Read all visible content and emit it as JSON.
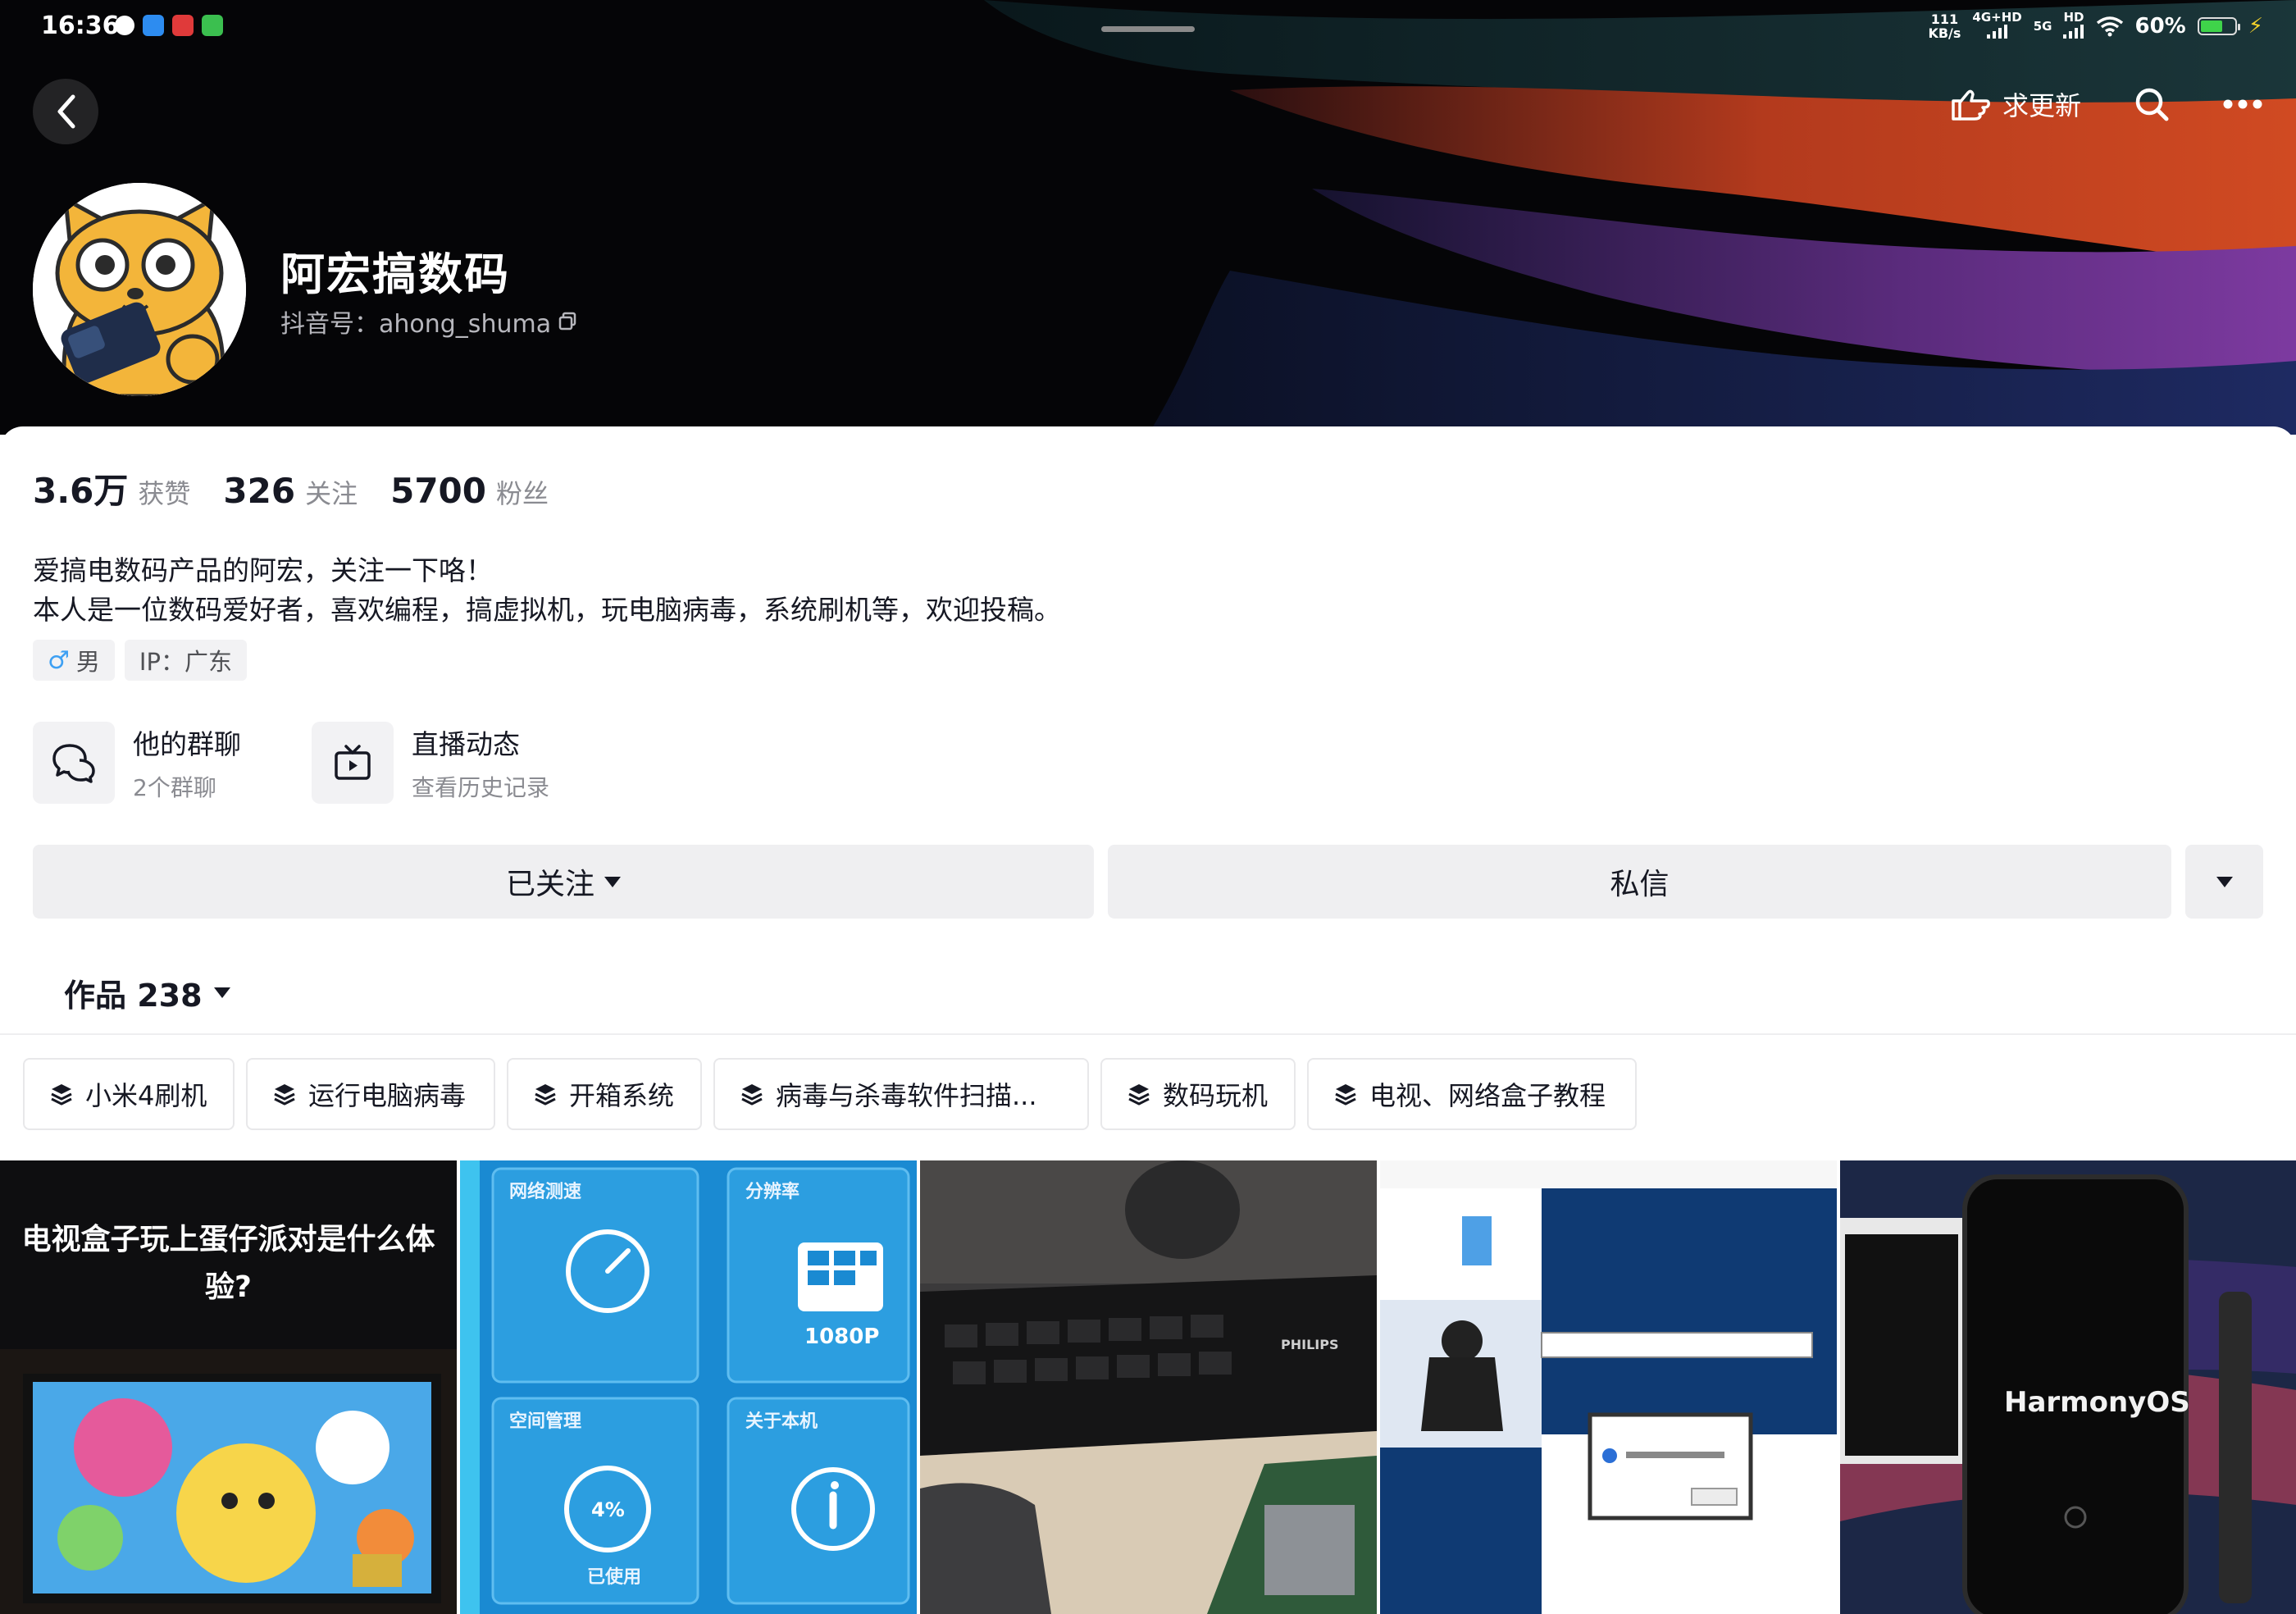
{
  "status_bar": {
    "time": "16:36",
    "net_speed_value": "111",
    "net_speed_unit": "KB/s",
    "signal_1_label": "4G+HD",
    "signal_2_label": "5G",
    "signal_3_label": "HD",
    "battery": "60%"
  },
  "nav": {
    "request_update_label": "求更新",
    "icons": [
      "back-icon",
      "hand-point-icon",
      "search-icon",
      "more-icon"
    ]
  },
  "profile": {
    "nickname": "阿宏搞数码",
    "douyin_id": "抖音号：ahong_shuma",
    "stats": [
      {
        "value": "3.6万",
        "label": "获赞"
      },
      {
        "value": "326",
        "label": "关注"
      },
      {
        "value": "5700",
        "label": "粉丝"
      }
    ],
    "bio_line1": "爱搞电数码产品的阿宏，关注一下咯！",
    "bio_line2": "本人是一位数码爱好者，喜欢编程，搞虚拟机，玩电脑病毒，系统刷机等，欢迎投稿。",
    "gender_symbol": "♂",
    "gender": "男",
    "ip": "IP：广东"
  },
  "features": {
    "group_chat": {
      "title": "他的群聊",
      "subtitle": "2个群聊"
    },
    "live": {
      "title": "直播动态",
      "subtitle": "查看历史记录"
    }
  },
  "actions": {
    "follow_label": "已关注",
    "message_label": "私信"
  },
  "works": {
    "tab_label": "作品 238"
  },
  "collections": [
    {
      "label": "小米4刷机"
    },
    {
      "label": "运行电脑病毒"
    },
    {
      "label": "开箱系统"
    },
    {
      "label": "病毒与杀毒软件扫描..."
    },
    {
      "label": "数码玩机"
    },
    {
      "label": "电视、网络盒子教程"
    }
  ],
  "videos": {
    "v1_caption": "电视盒子玩上蛋仔派对是什么体验?",
    "v2_labels": {
      "speed": "网络测速",
      "resolution": "分辨率",
      "res_value": "1080P",
      "storage": "空间管理",
      "storage_pct": "4%",
      "storage_used": "已使用",
      "about": "关于本机"
    },
    "v3_brand": "PHILIPS",
    "v5_os": "HarmonyOS"
  },
  "colors": {
    "accent_dark": "#161823",
    "muted": "#8a8b91",
    "button_bg": "#efeff1",
    "gender_blue": "#3ea0f3"
  }
}
